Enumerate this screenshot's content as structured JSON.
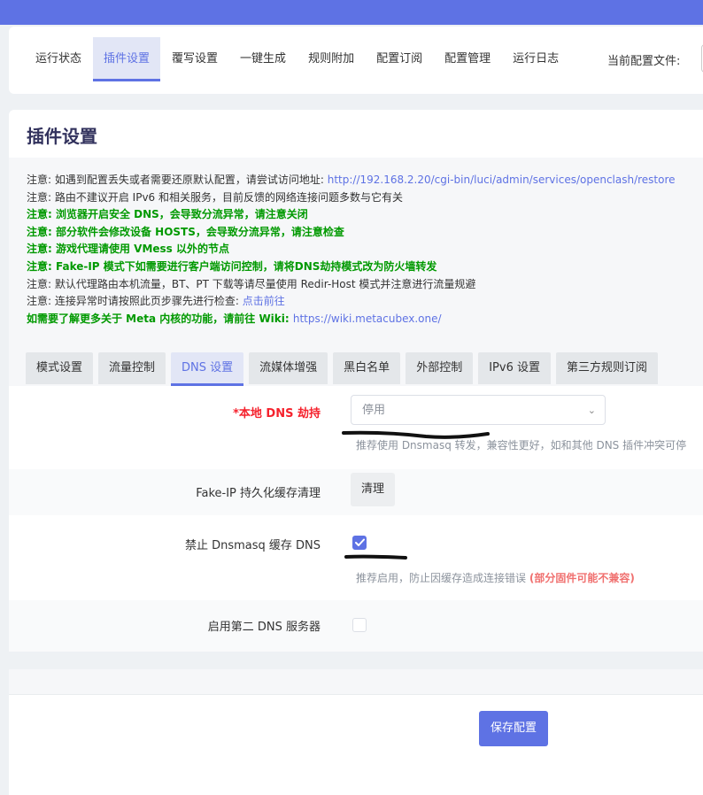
{
  "nav": {
    "items": [
      "运行状态",
      "插件设置",
      "覆写设置",
      "一键生成",
      "规则附加",
      "配置订阅",
      "配置管理",
      "运行日志"
    ],
    "active": "插件设置",
    "config_label": "当前配置文件:"
  },
  "page": {
    "title": "插件设置"
  },
  "notes": [
    {
      "text": "注意: 如遇到配置丢失或者需要还原默认配置，请尝试访问地址: ",
      "link": "http://192.168.2.20/cgi-bin/luci/admin/services/openclash/restore",
      "style": "normal"
    },
    {
      "text": "注意: 路由不建议开启 IPv6 和相关服务，目前反馈的网络连接问题多数与它有关",
      "style": "normal"
    },
    {
      "text": "注意: 浏览器开启安全 DNS，会导致分流异常，请注意关闭",
      "style": "green"
    },
    {
      "text": "注意: 部分软件会修改设备 HOSTS，会导致分流异常，请注意检查",
      "style": "green"
    },
    {
      "text": "注意: 游戏代理请使用 VMess 以外的节点",
      "style": "green"
    },
    {
      "text": "注意: Fake-IP 模式下如需要进行客户端访问控制，请将DNS劫持模式改为防火墙转发",
      "style": "green"
    },
    {
      "text": "注意: 默认代理路由本机流量，BT、PT 下载等请尽量使用 Redir-Host 模式并注意进行流量规避",
      "style": "normal"
    },
    {
      "text": "注意: 连接异常时请按照此页步骤先进行检查: ",
      "link": "点击前往",
      "style": "normal"
    },
    {
      "text": "如需要了解更多关于 Meta 内核的功能，请前往 Wiki: ",
      "link": "https://wiki.metacubex.one/",
      "style": "green"
    }
  ],
  "tabs": {
    "items": [
      "模式设置",
      "流量控制",
      "DNS 设置",
      "流媒体增强",
      "黑白名单",
      "外部控制",
      "IPv6 设置",
      "第三方规则订阅"
    ],
    "active": "DNS 设置"
  },
  "form": {
    "local_dns_hijack": {
      "label": "*本地 DNS 劫持",
      "value": "停用",
      "help": "推荐使用 Dnsmasq 转发，兼容性更好，如和其他 DNS 插件冲突可停"
    },
    "fakeip_cache": {
      "label": "Fake-IP 持久化缓存清理",
      "button": "清理"
    },
    "disable_dnsmasq_cache": {
      "label": "禁止 Dnsmasq 缓存 DNS",
      "checked": true,
      "help": "推荐启用，防止因缓存造成连接错误",
      "help_warn": "(部分固件可能不兼容)"
    },
    "second_dns": {
      "label": "启用第二 DNS 服务器",
      "checked": false
    }
  },
  "footer": {
    "save_label": "保存配置"
  },
  "colors": {
    "accent": "#5e72e4",
    "note_green": "#009900",
    "required_red": "#f5222d"
  },
  "icons": {
    "select_arrow": "chevron-down-icon",
    "check": "check-icon"
  }
}
